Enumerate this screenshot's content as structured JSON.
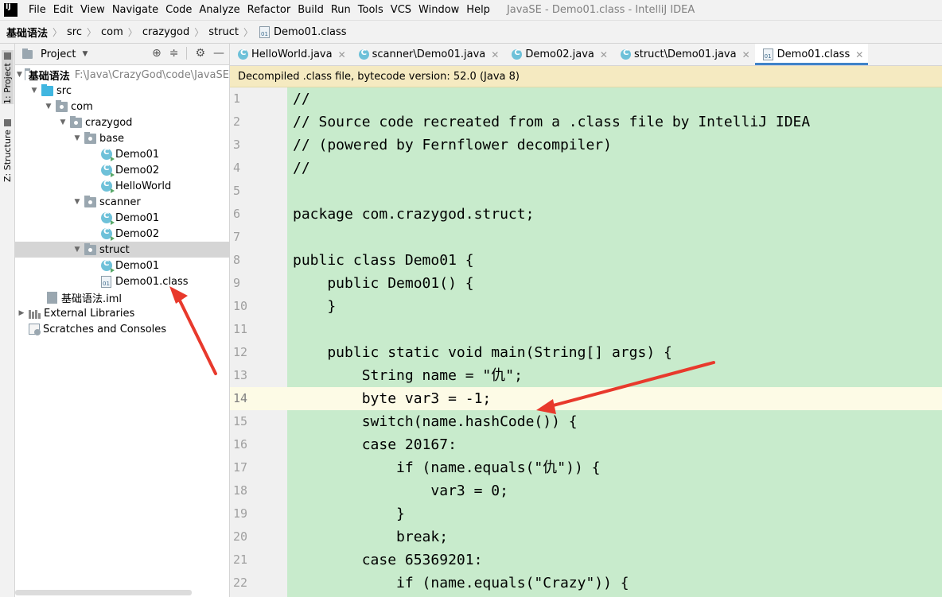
{
  "menubar": {
    "items": [
      "File",
      "Edit",
      "View",
      "Navigate",
      "Code",
      "Analyze",
      "Refactor",
      "Build",
      "Run",
      "Tools",
      "VCS",
      "Window",
      "Help"
    ],
    "window_title": "JavaSE - Demo01.class - IntelliJ IDEA"
  },
  "breadcrumb": [
    "基础语法",
    "src",
    "com",
    "crazygod",
    "struct",
    "Demo01.class"
  ],
  "toolstrip": {
    "project_tab": "1: Project",
    "structure_tab": "Z: Structure"
  },
  "project_panel": {
    "title": "Project",
    "root_label": "基础语法",
    "root_path": "F:\\Java\\CrazyGod\\code\\JavaSE",
    "tree": {
      "src": "src",
      "com": "com",
      "crazygod": "crazygod",
      "base": "base",
      "base_demo01": "Demo01",
      "base_demo02": "Demo02",
      "base_helloworld": "HelloWorld",
      "scanner": "scanner",
      "scanner_demo01": "Demo01",
      "scanner_demo02": "Demo02",
      "struct": "struct",
      "struct_demo01": "Demo01",
      "struct_demo01_class": "Demo01.class",
      "iml": "基础语法.iml",
      "external_libraries": "External Libraries",
      "scratches": "Scratches and Consoles"
    }
  },
  "tabs": [
    {
      "label": "HelloWorld.java",
      "type": "java"
    },
    {
      "label": "scanner\\Demo01.java",
      "type": "java"
    },
    {
      "label": "Demo02.java",
      "type": "java"
    },
    {
      "label": "struct\\Demo01.java",
      "type": "java"
    },
    {
      "label": "Demo01.class",
      "type": "class",
      "active": true
    }
  ],
  "banner": "Decompiled .class file, bytecode version: 52.0 (Java 8)",
  "editor": {
    "current_line": 14,
    "lines": [
      {
        "n": "1",
        "code": "//"
      },
      {
        "n": "2",
        "code": "// Source code recreated from a .class file by IntelliJ IDEA"
      },
      {
        "n": "3",
        "code": "// (powered by Fernflower decompiler)"
      },
      {
        "n": "4",
        "code": "//"
      },
      {
        "n": "5",
        "code": ""
      },
      {
        "n": "6",
        "code": "package com.crazygod.struct;"
      },
      {
        "n": "7",
        "code": ""
      },
      {
        "n": "8",
        "code": "public class Demo01 {"
      },
      {
        "n": "9",
        "code": "    public Demo01() {"
      },
      {
        "n": "10",
        "code": "    }"
      },
      {
        "n": "11",
        "code": ""
      },
      {
        "n": "12",
        "code": "    public static void main(String[] args) {"
      },
      {
        "n": "13",
        "code": "        String name = \"仇\";"
      },
      {
        "n": "14",
        "code": "        byte var3 = -1;"
      },
      {
        "n": "15",
        "code": "        switch(name.hashCode()) {"
      },
      {
        "n": "16",
        "code": "        case 20167:"
      },
      {
        "n": "17",
        "code": "            if (name.equals(\"仇\")) {"
      },
      {
        "n": "18",
        "code": "                var3 = 0;"
      },
      {
        "n": "19",
        "code": "            }"
      },
      {
        "n": "20",
        "code": "            break;"
      },
      {
        "n": "21",
        "code": "        case 65369201:"
      },
      {
        "n": "22",
        "code": "            if (name.equals(\"Crazy\")) {"
      }
    ]
  },
  "colors": {
    "code_background": "#c8ebcc",
    "current_line": "#fdfbe6",
    "banner": "#f5eac1",
    "arrow": "#e8392c",
    "tab_underline": "#4083c9"
  }
}
